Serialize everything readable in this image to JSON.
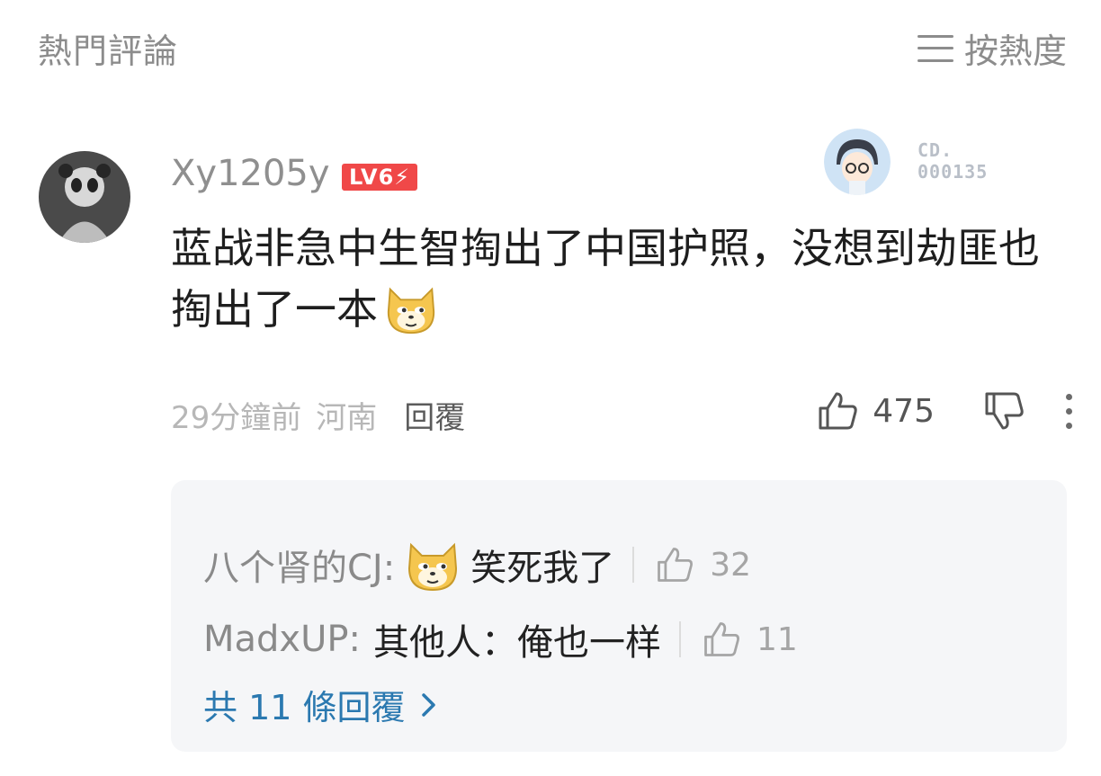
{
  "header": {
    "title": "熱門評論",
    "sort_label": "按熱度",
    "sort_icon": "menu-lines-icon"
  },
  "comment": {
    "username": "Xy1205y",
    "level_badge": "LV6",
    "fan_badge": {
      "line1": "CD.",
      "line2": "000135"
    },
    "text": "蓝战非急中生智掏出了中国护照，没想到劫匪也掏出了一本",
    "emoji": "doge-emoji",
    "time": "29分鐘前",
    "location": "河南",
    "reply_label": "回覆",
    "like_count": "475"
  },
  "replies": [
    {
      "author": "八个肾的CJ:",
      "emoji": "doge-emoji",
      "text": "笑死我了",
      "likes": "32"
    },
    {
      "author": "MadxUP:",
      "text": "其他人：俺也一样",
      "likes": "11"
    }
  ],
  "more_replies_label": "共 11 條回覆",
  "colors": {
    "accent": "#2b79b0",
    "badge": "#f04848",
    "reply_bg": "#f5f6f8"
  }
}
